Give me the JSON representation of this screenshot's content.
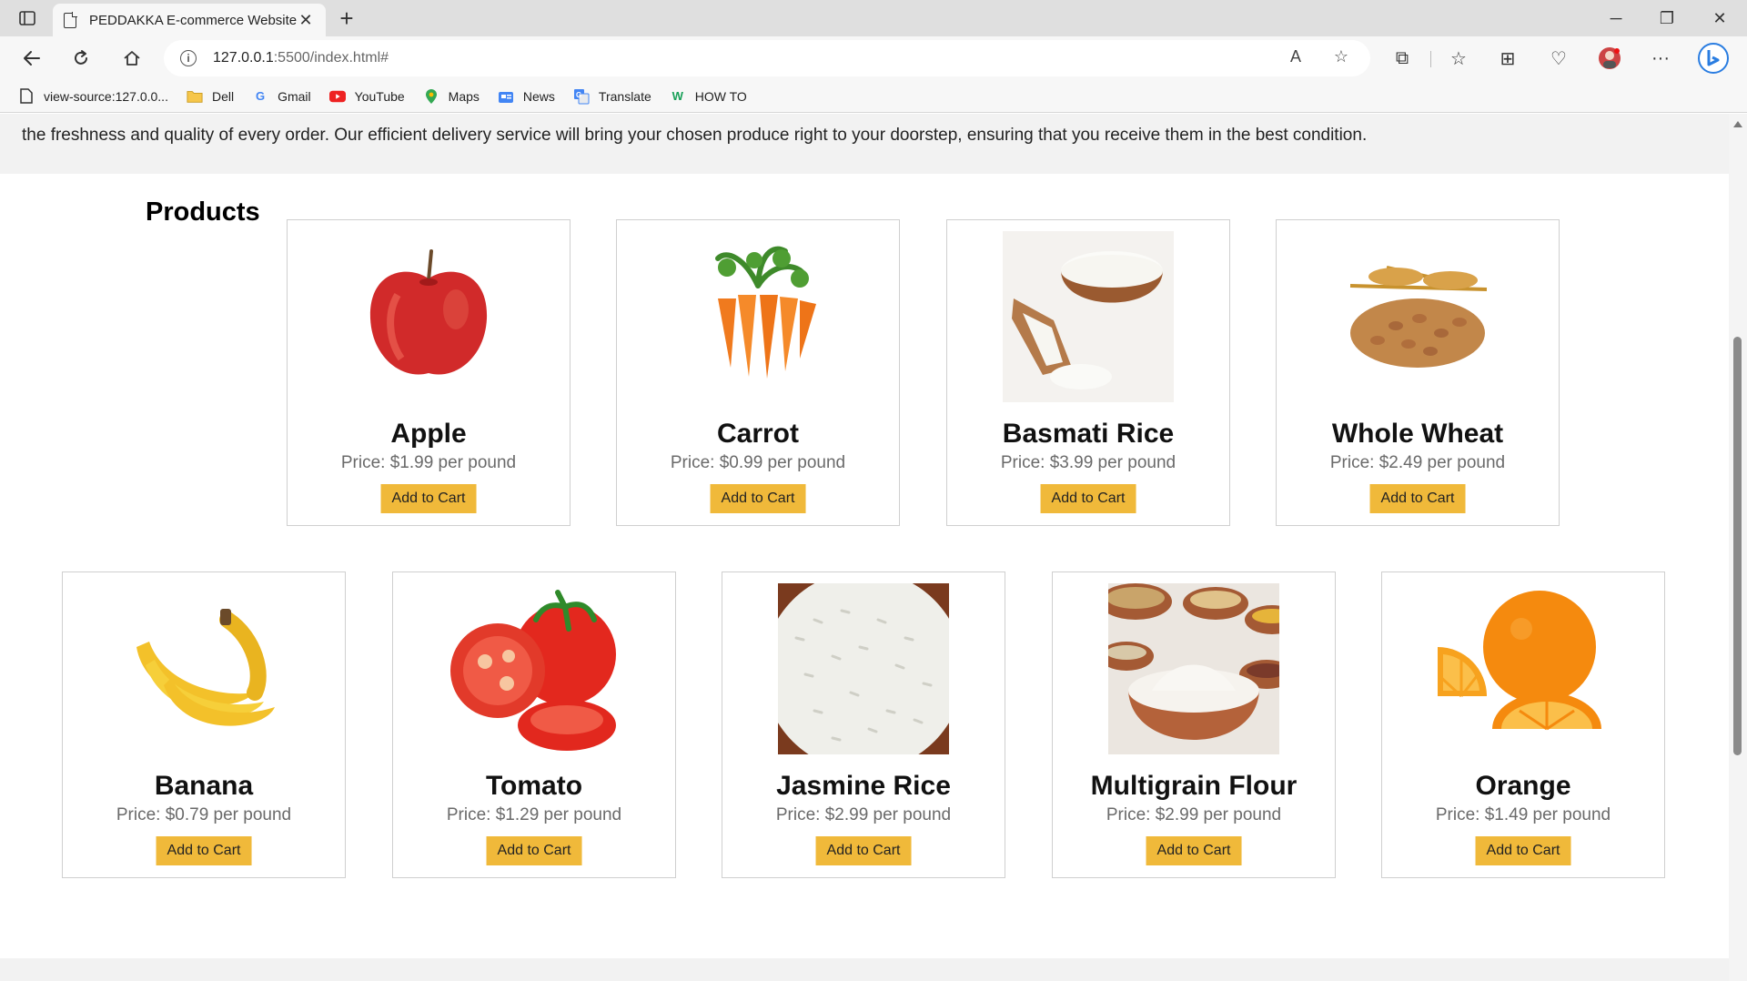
{
  "browser": {
    "tab_title": "PEDDAKKA E-commerce Website",
    "tab_close": "✕",
    "new_tab": "+",
    "url_host": "127.0.0.1",
    "url_rest": ":5500/index.html#",
    "window": {
      "minimize": "─",
      "restore": "❐",
      "close": "✕"
    },
    "more_label": "···",
    "bookmarks": [
      {
        "label": "view-source:127.0.0...",
        "icon": "page-icon"
      },
      {
        "label": "Dell",
        "icon": "folder-icon"
      },
      {
        "label": "Gmail",
        "icon": "google-icon"
      },
      {
        "label": "YouTube",
        "icon": "youtube-icon"
      },
      {
        "label": "Maps",
        "icon": "maps-icon"
      },
      {
        "label": "News",
        "icon": "news-icon"
      },
      {
        "label": "Translate",
        "icon": "translate-icon"
      },
      {
        "label": "HOW TO",
        "icon": "howto-icon"
      }
    ]
  },
  "page": {
    "about_text": "the freshness and quality of every order. Our efficient delivery service will bring your chosen produce right to your doorstep, ensuring that you receive them in the best condition.",
    "products_heading": "Products",
    "add_to_cart_label": "Add to Cart",
    "products": [
      {
        "name": "Apple",
        "price": "Price: $1.99 per pound",
        "image": "apple-image"
      },
      {
        "name": "Carrot",
        "price": "Price: $0.99 per pound",
        "image": "carrot-image"
      },
      {
        "name": "Basmati Rice",
        "price": "Price: $3.99 per pound",
        "image": "basmati-rice-image"
      },
      {
        "name": "Whole Wheat",
        "price": "Price: $2.49 per pound",
        "image": "wheat-image"
      },
      {
        "name": "Banana",
        "price": "Price: $0.79 per pound",
        "image": "banana-image"
      },
      {
        "name": "Tomato",
        "price": "Price: $1.29 per pound",
        "image": "tomato-image"
      },
      {
        "name": "Jasmine Rice",
        "price": "Price: $2.99 per pound",
        "image": "jasmine-rice-image"
      },
      {
        "name": "Multigrain Flour",
        "price": "Price: $2.99 per pound",
        "image": "flour-image"
      },
      {
        "name": "Orange",
        "price": "Price: $1.49 per pound",
        "image": "orange-image"
      }
    ]
  },
  "colors": {
    "button": "#f0b93a",
    "price_text": "#6a6a6a",
    "card_border": "#cfcfcf",
    "strip_bg": "#f2f2f2"
  }
}
